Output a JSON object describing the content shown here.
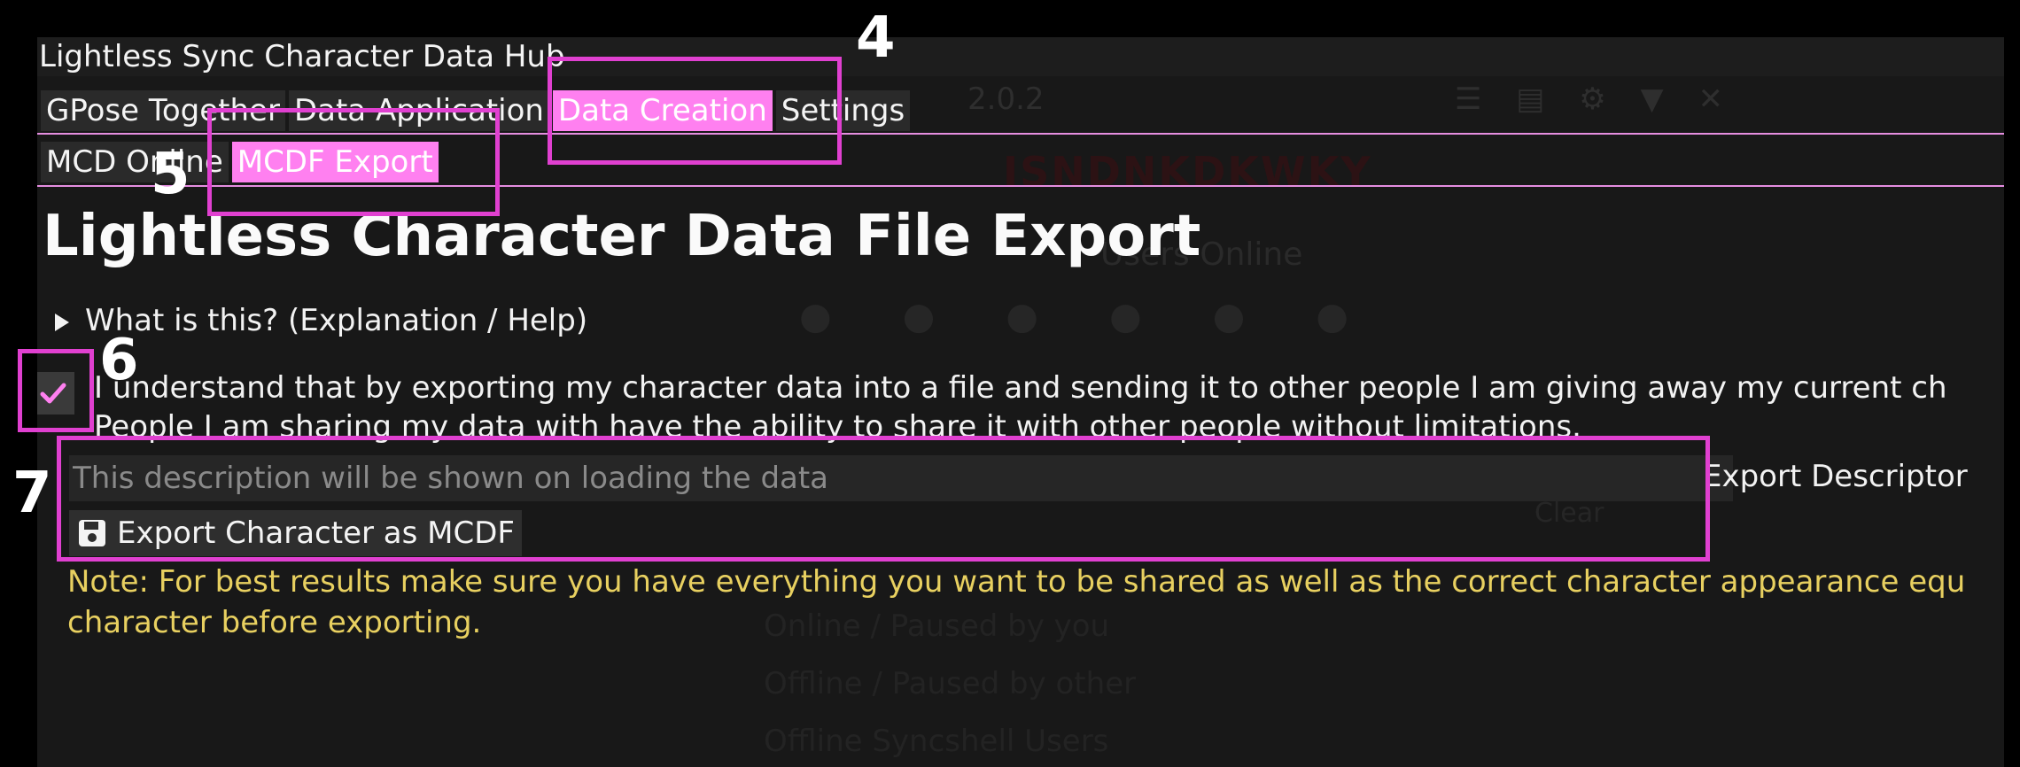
{
  "window": {
    "title": "Lightless Sync Character Data Hub"
  },
  "main_tabs": [
    {
      "label": "GPose Together",
      "active": false
    },
    {
      "label": "Data Application",
      "active": false
    },
    {
      "label": "Data Creation",
      "active": true
    },
    {
      "label": "Settings",
      "active": false
    }
  ],
  "sub_tabs": [
    {
      "label": "MCD Online",
      "active": false
    },
    {
      "label": "MCDF Export",
      "active": true
    }
  ],
  "page": {
    "heading": "Lightless Character Data File Export",
    "help_toggle": "What is this? (Explanation / Help)",
    "agree_line1": "I understand that by exporting my character data into a file and sending it to other people I am giving away my current ch",
    "agree_line2": "People I am sharing my data with have the ability to share it with other people without limitations.",
    "agree_checked": true,
    "description_placeholder": "This description will be shown on loading the data",
    "description_value": "",
    "description_label": "Export Descriptor",
    "export_button": "Export Character as MCDF",
    "note_line1": "Note: For best results make sure you have everything you want to be shared as well as the correct character appearance equ",
    "note_line2": "character before exporting."
  },
  "background_ghost": {
    "version": "2.0.2",
    "title": "ISNDNKDKWKY",
    "users": "Users Online",
    "row1": "Online / Paused by you",
    "row2": "Offline / Paused by other",
    "row3": "Offline Syncshell Users",
    "clear": "Clear"
  },
  "annotations": [
    "4",
    "5",
    "6",
    "7"
  ],
  "colors": {
    "accent_pink": "#ff80f0",
    "annotation_magenta": "#e040d0",
    "note_yellow": "#e8d060",
    "window_bg": "#181818"
  }
}
